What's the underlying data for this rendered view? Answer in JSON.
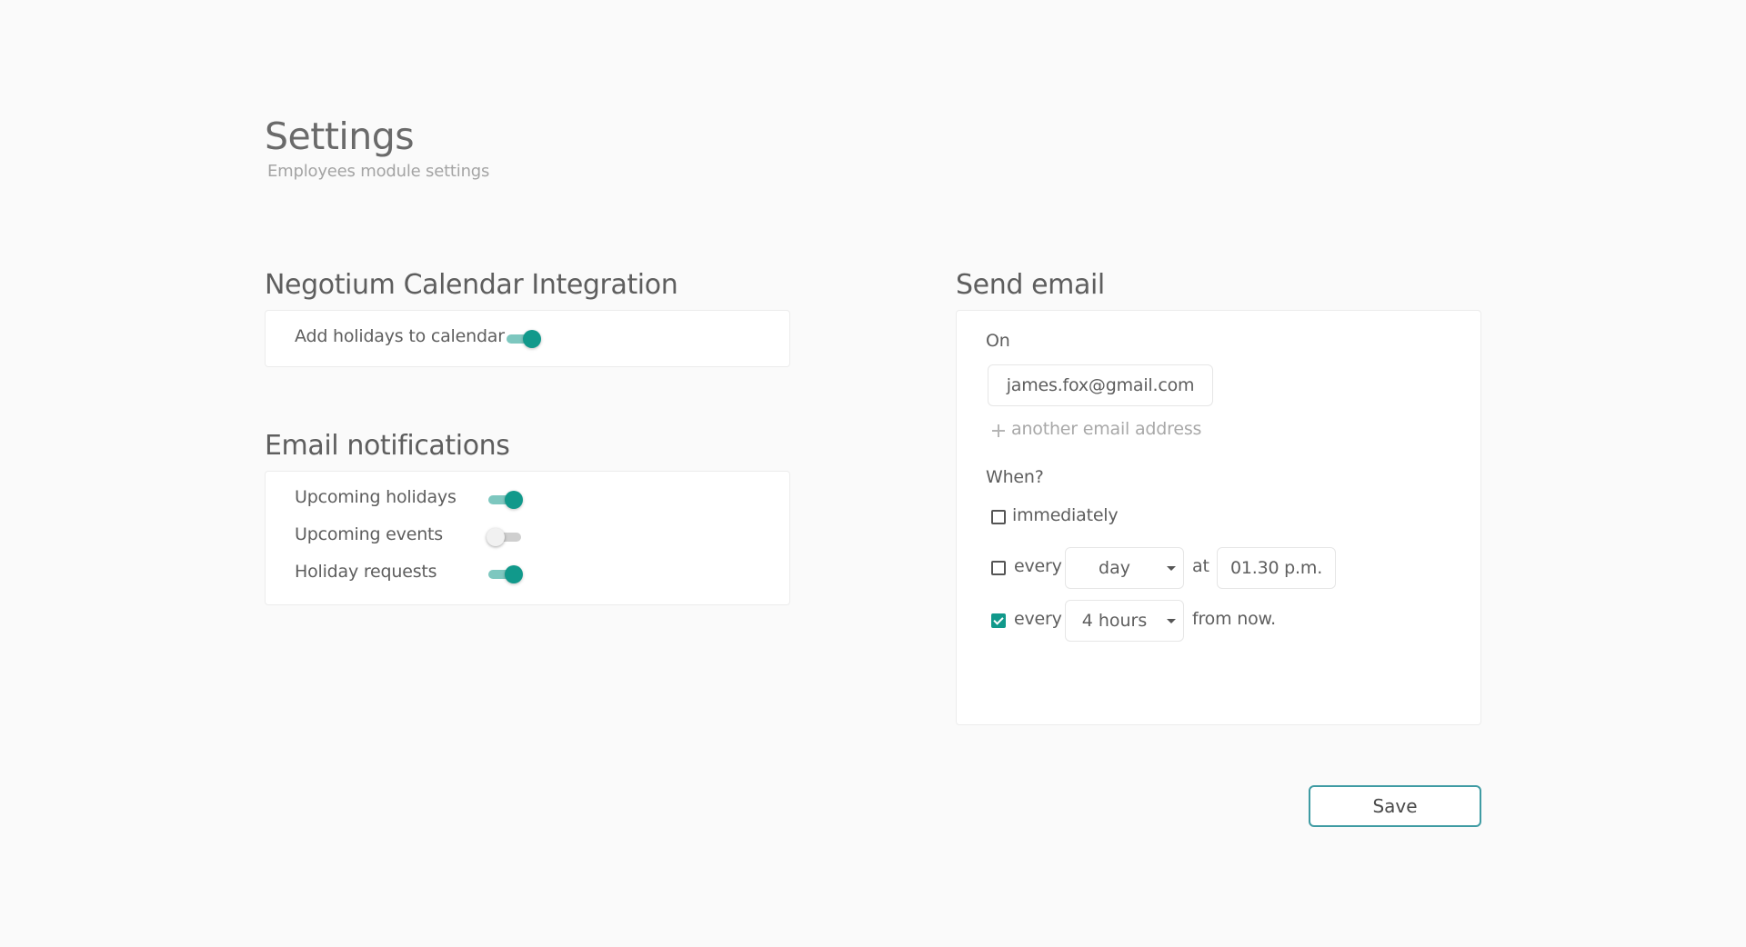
{
  "header": {
    "title": "Settings",
    "subtitle": "Employees module settings"
  },
  "calendar_integration": {
    "title": "Negotium Calendar Integration",
    "add_holidays_label": "Add holidays to calendar",
    "add_holidays_on": true
  },
  "email_notifications": {
    "title": "Email notifications",
    "items": [
      {
        "label": "Upcoming holidays",
        "on": true
      },
      {
        "label": "Upcoming events",
        "on": false
      },
      {
        "label": "Holiday requests",
        "on": true
      }
    ]
  },
  "send_email": {
    "title": "Send email",
    "on_label": "On",
    "email": "james.fox@gmail.com",
    "add_email_label": "another email address",
    "when_label": "When?",
    "immediately_label": "immediately",
    "immediately_checked": false,
    "schedule_every_label": "every",
    "schedule_every_checked": false,
    "schedule_period": "day",
    "schedule_at_label": "at",
    "schedule_time": "01.30 p.m.",
    "interval_every_label": "every",
    "interval_checked": true,
    "interval_value": "4 hours",
    "interval_suffix": "from now."
  },
  "actions": {
    "save_label": "Save"
  },
  "colors": {
    "accent": "#11998b",
    "save_border": "#3f9ba3"
  }
}
